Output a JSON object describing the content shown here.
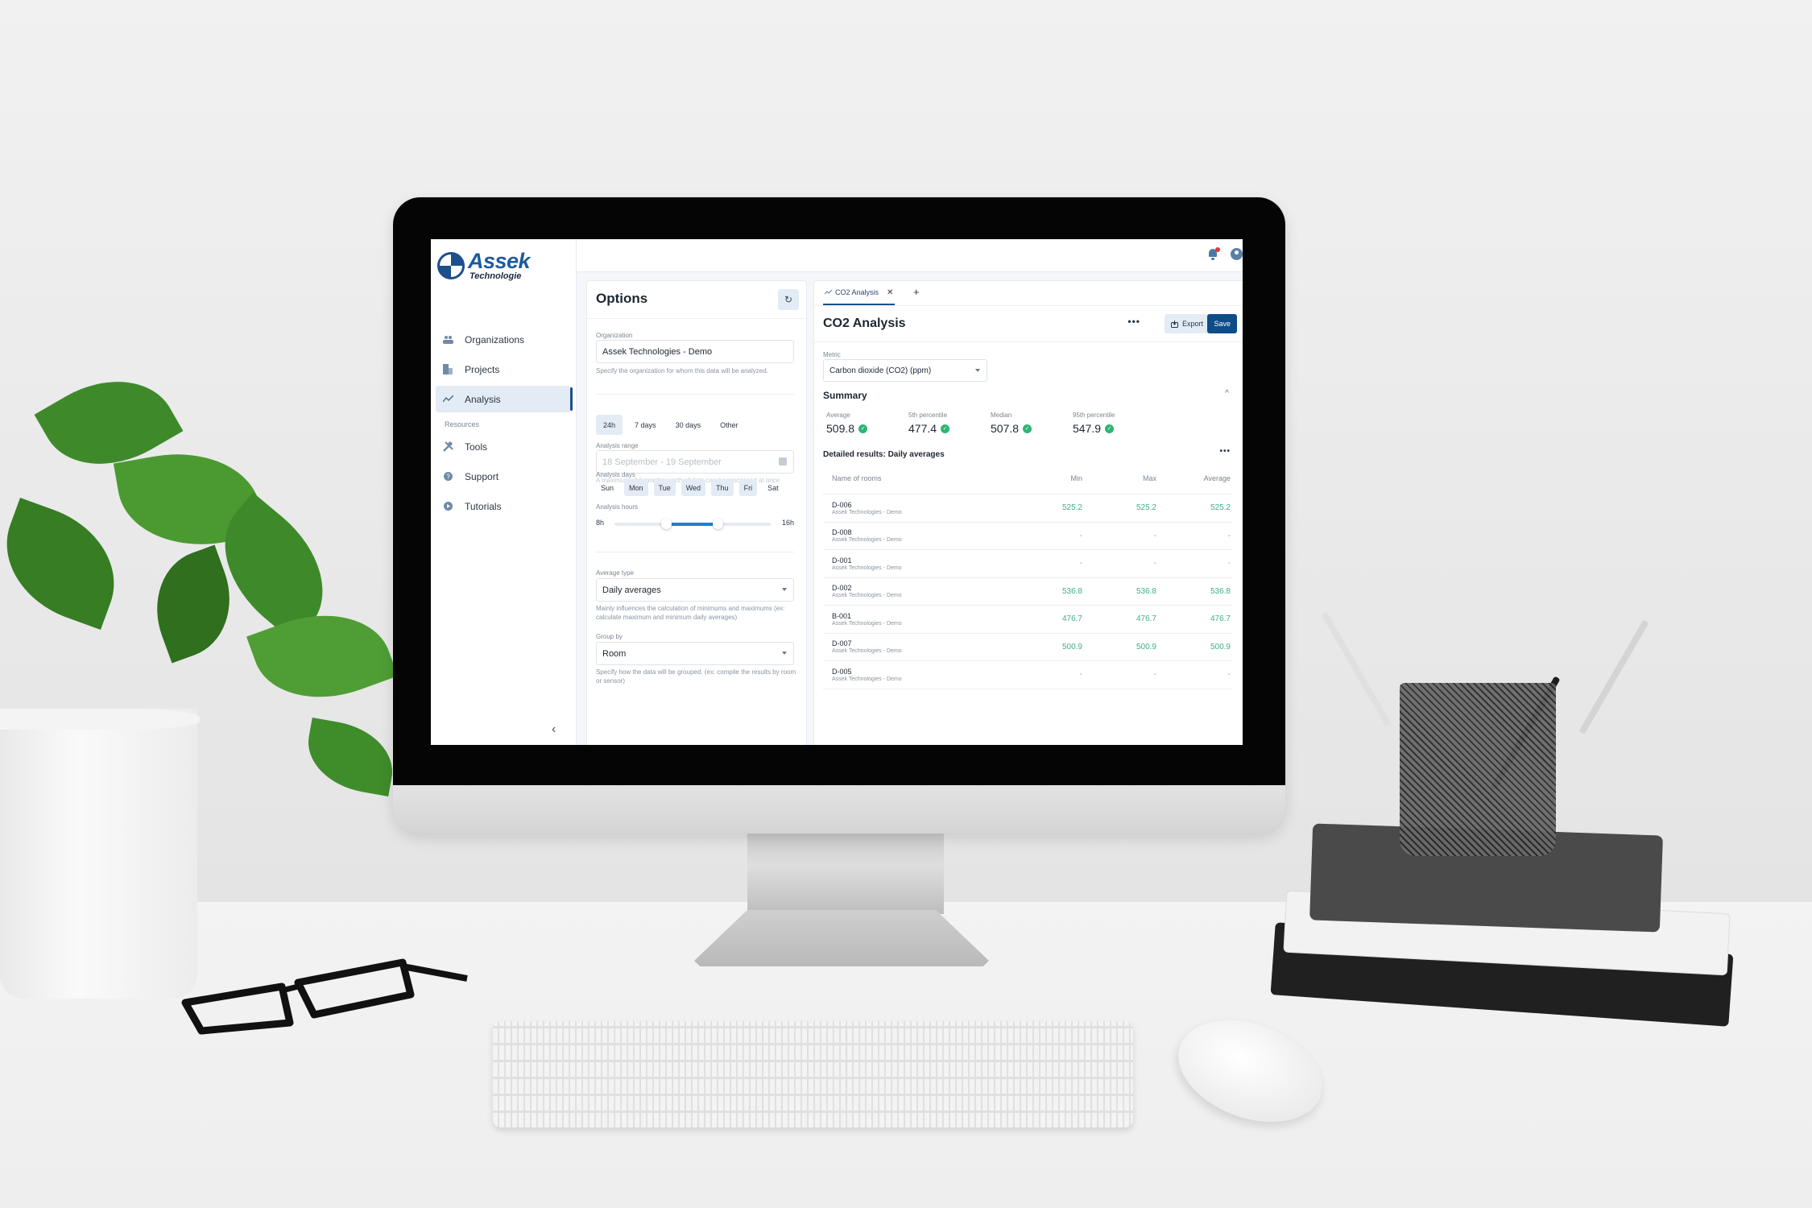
{
  "app": {
    "brand_name": "Assek",
    "brand_sub": "Technologie"
  },
  "sidebar": {
    "items": [
      {
        "label": "Organizations",
        "icon": "people-icon",
        "active": false
      },
      {
        "label": "Projects",
        "icon": "building-icon",
        "active": false
      },
      {
        "label": "Analysis",
        "icon": "trend-line-icon",
        "active": true
      }
    ],
    "section_label": "Resources",
    "resources": [
      {
        "label": "Tools",
        "icon": "tools-icon"
      },
      {
        "label": "Support",
        "icon": "help-circle-icon"
      },
      {
        "label": "Tutorials",
        "icon": "play-circle-icon"
      }
    ],
    "collapse_icon": "chevron-left-icon"
  },
  "topbar": {
    "notification_icon": "bell-icon",
    "has_notification": true,
    "user_icon": "user-circle-icon"
  },
  "options": {
    "title": "Options",
    "refresh_icon": "refresh-icon",
    "organization": {
      "label": "Organization",
      "value": "Assek Technologies - Demo",
      "hint": "Specify the organization for whom this data will be analyzed."
    },
    "period_tabs": [
      {
        "label": "24h",
        "active": true
      },
      {
        "label": "7 days",
        "active": false
      },
      {
        "label": "30 days",
        "active": false
      },
      {
        "label": "Other",
        "active": false
      }
    ],
    "analysis_range": {
      "label": "Analysis range",
      "value": "18 September - 19 September",
      "hint": "A maximum of 1 months worth of data can be processed at once"
    },
    "analysis_days": {
      "label": "Analysis days",
      "days": [
        {
          "label": "Sun",
          "selected": false
        },
        {
          "label": "Mon",
          "selected": true
        },
        {
          "label": "Tue",
          "selected": true
        },
        {
          "label": "Wed",
          "selected": true
        },
        {
          "label": "Thu",
          "selected": true
        },
        {
          "label": "Fri",
          "selected": true
        },
        {
          "label": "Sat",
          "selected": false
        }
      ]
    },
    "analysis_hours": {
      "label": "Analysis hours",
      "min_label": "8h",
      "max_label": "16h",
      "range_start_fraction": 0.33,
      "range_end_fraction": 0.66
    },
    "average_type": {
      "label": "Average type",
      "value": "Daily averages",
      "hint": "Mainly influences the calculation of minimums and maximums (ex: calculate maximum and minimum daily averages)"
    },
    "group_by": {
      "label": "Group by",
      "value": "Room",
      "hint": "Specify how the data will be grouped. (ex: compile the results by room or sensor)"
    }
  },
  "analysis": {
    "tab_label": "CO2 Analysis",
    "tab_icon": "trend-line-icon",
    "title": "CO2 Analysis",
    "more_label": "•••",
    "export_label": "Export",
    "save_label": "Save",
    "metric": {
      "label": "Metric",
      "value": "Carbon dioxide (CO2) (ppm)"
    },
    "summary": {
      "title": "Summary",
      "stats": [
        {
          "label": "Average",
          "value": "509.8",
          "status": "ok"
        },
        {
          "label": "5th percentile",
          "value": "477.4",
          "status": "ok"
        },
        {
          "label": "Median",
          "value": "507.8",
          "status": "ok"
        },
        {
          "label": "95th percentile",
          "value": "547.9",
          "status": "ok"
        }
      ]
    },
    "details": {
      "title": "Detailed results: Daily averages",
      "columns": [
        "Name of rooms",
        "Min",
        "Max",
        "Average"
      ],
      "rows": [
        {
          "room": "D-006",
          "org": "Assek Technologies - Demo",
          "min": "525.2",
          "max": "525.2",
          "avg": "525.2"
        },
        {
          "room": "D-008",
          "org": "Assek Technologies - Demo",
          "min": "-",
          "max": "-",
          "avg": "-"
        },
        {
          "room": "D-001",
          "org": "Assek Technologies - Demo",
          "min": "-",
          "max": "-",
          "avg": "-"
        },
        {
          "room": "D-002",
          "org": "Assek Technologies - Demo",
          "min": "536.8",
          "max": "536.8",
          "avg": "536.8"
        },
        {
          "room": "B-001",
          "org": "Assek Technologies - Demo",
          "min": "476.7",
          "max": "476.7",
          "avg": "476.7"
        },
        {
          "room": "D-007",
          "org": "Assek Technologies - Demo",
          "min": "500.9",
          "max": "500.9",
          "avg": "500.9"
        },
        {
          "room": "D-005",
          "org": "Assek Technologies - Demo",
          "min": "-",
          "max": "-",
          "avg": "-"
        }
      ]
    }
  },
  "colors": {
    "accent": "#0e4c8a",
    "active_bg": "#e3ebf4",
    "value_green": "#3fae8c",
    "check_green": "#2bb673",
    "notification_dot": "#e53935",
    "slider_fill": "#1e7fcf"
  }
}
